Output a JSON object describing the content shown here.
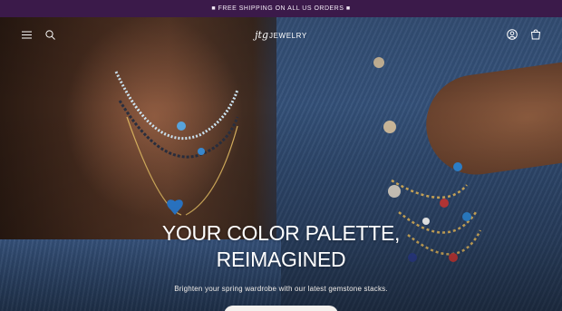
{
  "announcement": {
    "text": "■ FREE SHIPPING ON ALL US ORDERS ■"
  },
  "header": {
    "logo_monogram": "jtg",
    "logo_word": "JEWELRY",
    "icons": [
      "menu-icon",
      "search-icon",
      "account-icon",
      "cart-icon"
    ]
  },
  "hero": {
    "headline_line1": "YOUR COLOR PALETTE,",
    "headline_line2": "REIMAGINED",
    "subtext": "Brighten your spring wardrobe with our latest gemstone stacks."
  },
  "colors": {
    "announcement_bg": "#3b1a4a",
    "text": "#ffffff",
    "cta_bg": "#f4f1ee"
  }
}
